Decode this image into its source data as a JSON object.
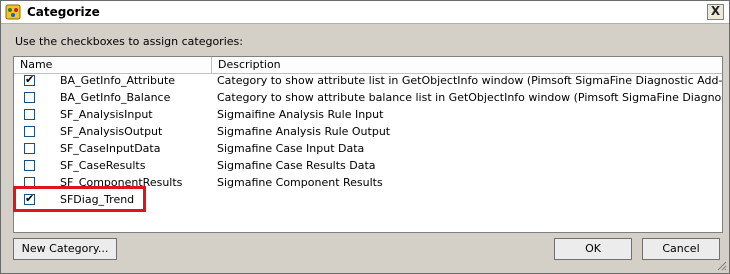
{
  "window": {
    "title": "Categorize",
    "close_label": "X"
  },
  "instructions": "Use the checkboxes to assign categories:",
  "grid": {
    "columns": [
      "Name",
      "Description"
    ],
    "rows": [
      {
        "checked": true,
        "name": "BA_GetInfo_Attribute",
        "description": "Category to show attribute list in GetObjectInfo window (Pimsoft SigmaFine Diagnostic Add-In)"
      },
      {
        "checked": false,
        "name": "BA_GetInfo_Balance",
        "description": "Category to show attribute balance list in GetObjectInfo window (Pimsoft SigmaFine Diagnostic Add"
      },
      {
        "checked": false,
        "name": "SF_AnalysisInput",
        "description": "Sigmaifine Analysis Rule Input"
      },
      {
        "checked": false,
        "name": "SF_AnalysisOutput",
        "description": "Sigmafine Analysis Rule Output"
      },
      {
        "checked": false,
        "name": "SF_CaseInputData",
        "description": "Sigmafine Case Input Data"
      },
      {
        "checked": false,
        "name": "SF_CaseResults",
        "description": "Sigmafine Case Results Data"
      },
      {
        "checked": false,
        "name": "SF_ComponentResults",
        "description": "Sigmafine Component Results"
      },
      {
        "checked": true,
        "name": "SFDiag_Trend",
        "description": ""
      }
    ]
  },
  "buttons": {
    "new_category": "New Category...",
    "ok": "OK",
    "cancel": "Cancel"
  },
  "colors": {
    "highlight": "#e3131b",
    "checkbox_border": "#1c5180"
  }
}
